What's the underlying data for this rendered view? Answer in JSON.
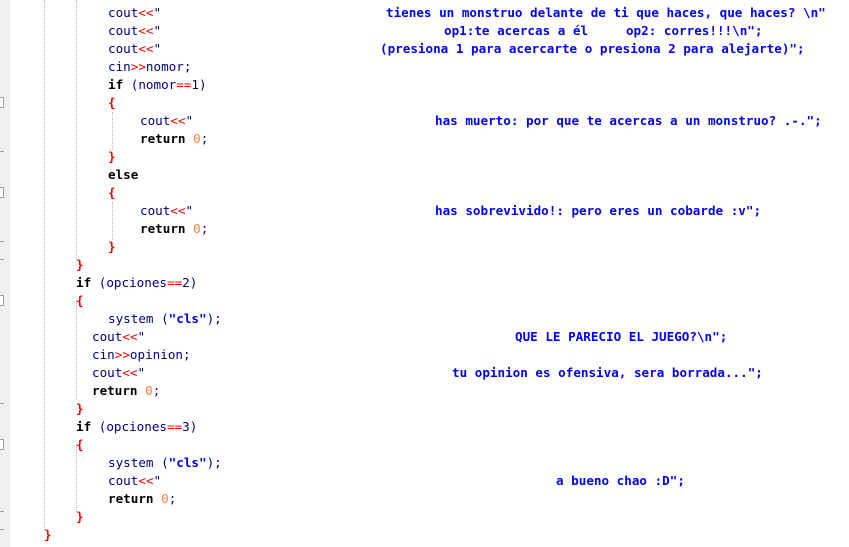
{
  "editor": {
    "language": "C++",
    "lines": [
      {
        "tokens": [
          {
            "t": "cout",
            "c": "code"
          },
          {
            "t": "<<",
            "c": "op"
          },
          {
            "t": "\"",
            "c": "code"
          }
        ],
        "tail": "tienes un monstruo delante de ti que haces, que haces? \\n\""
      },
      {
        "tokens": [
          {
            "t": "cout",
            "c": "code"
          },
          {
            "t": "<<",
            "c": "op"
          },
          {
            "t": "\"",
            "c": "code"
          }
        ],
        "tail": "op1:te acercas a él     op2: corres!!!\\n\";"
      },
      {
        "tokens": [
          {
            "t": "cout",
            "c": "code"
          },
          {
            "t": "<<",
            "c": "op"
          },
          {
            "t": "\"",
            "c": "code"
          }
        ],
        "tail": "(presiona 1 para acercarte o presiona 2 para alejarte)\";"
      },
      {
        "tokens": [
          {
            "t": "cin",
            "c": "code"
          },
          {
            "t": ">>",
            "c": "op"
          },
          {
            "t": "nomor;",
            "c": "code"
          }
        ]
      },
      {
        "tokens": [
          {
            "t": "if",
            "c": "kw"
          },
          {
            "t": " (nomor",
            "c": "code"
          },
          {
            "t": "==",
            "c": "op"
          },
          {
            "t": "1)",
            "c": "code"
          }
        ]
      },
      {
        "tokens": [
          {
            "t": "{",
            "c": "brace"
          }
        ]
      },
      {
        "tokens": [
          {
            "t": "cout",
            "c": "code"
          },
          {
            "t": "<<",
            "c": "op"
          },
          {
            "t": "\"",
            "c": "code"
          }
        ],
        "tail": "has muerto: por que te acercas a un monstruo? .-.\";"
      },
      {
        "tokens": [
          {
            "t": "return",
            "c": "kw"
          },
          {
            "t": " ",
            "c": "code"
          },
          {
            "t": "0",
            "c": "num"
          },
          {
            "t": ";",
            "c": "code"
          }
        ]
      },
      {
        "tokens": [
          {
            "t": "}",
            "c": "brace"
          }
        ]
      },
      {
        "tokens": [
          {
            "t": "else",
            "c": "kw"
          }
        ]
      },
      {
        "tokens": [
          {
            "t": "{",
            "c": "brace"
          }
        ]
      },
      {
        "tokens": [
          {
            "t": "cout",
            "c": "code"
          },
          {
            "t": "<<",
            "c": "op"
          },
          {
            "t": "\"",
            "c": "code"
          }
        ],
        "tail": "has sobrevivido!: pero eres un cobarde :v\";"
      },
      {
        "tokens": [
          {
            "t": "return",
            "c": "kw"
          },
          {
            "t": " ",
            "c": "code"
          },
          {
            "t": "0",
            "c": "num"
          },
          {
            "t": ";",
            "c": "code"
          }
        ]
      },
      {
        "tokens": [
          {
            "t": "}",
            "c": "brace"
          }
        ]
      },
      {
        "tokens": [
          {
            "t": "}",
            "c": "brace"
          }
        ]
      },
      {
        "tokens": [
          {
            "t": "if",
            "c": "kw"
          },
          {
            "t": " (opciones",
            "c": "code"
          },
          {
            "t": "==",
            "c": "op"
          },
          {
            "t": "2)",
            "c": "code"
          }
        ]
      },
      {
        "tokens": [
          {
            "t": "{",
            "c": "brace"
          }
        ]
      },
      {
        "tokens": [
          {
            "t": "system (",
            "c": "code"
          },
          {
            "t": "\"cls\"",
            "c": "str"
          },
          {
            "t": ");",
            "c": "code"
          }
        ]
      },
      {
        "tokens": [
          {
            "t": "cout",
            "c": "code"
          },
          {
            "t": "<<",
            "c": "op"
          },
          {
            "t": "\"",
            "c": "code"
          }
        ],
        "tail": "QUE LE PARECIO EL JUEGO?\\n\";"
      },
      {
        "tokens": [
          {
            "t": "cin",
            "c": "code"
          },
          {
            "t": ">>",
            "c": "op"
          },
          {
            "t": "opinion;",
            "c": "code"
          }
        ]
      },
      {
        "tokens": [
          {
            "t": "cout",
            "c": "code"
          },
          {
            "t": "<<",
            "c": "op"
          },
          {
            "t": "\"",
            "c": "code"
          }
        ],
        "tail": "tu opinion es ofensiva, sera borrada...\";"
      },
      {
        "tokens": [
          {
            "t": "return",
            "c": "kw"
          },
          {
            "t": " ",
            "c": "code"
          },
          {
            "t": "0",
            "c": "num"
          },
          {
            "t": ";",
            "c": "code"
          }
        ]
      },
      {
        "tokens": [
          {
            "t": "}",
            "c": "brace"
          }
        ]
      },
      {
        "tokens": [
          {
            "t": "if",
            "c": "kw"
          },
          {
            "t": " (opciones",
            "c": "code"
          },
          {
            "t": "==",
            "c": "op"
          },
          {
            "t": "3)",
            "c": "code"
          }
        ]
      },
      {
        "tokens": [
          {
            "t": "{",
            "c": "brace"
          }
        ]
      },
      {
        "tokens": [
          {
            "t": "system (",
            "c": "code"
          },
          {
            "t": "\"cls\"",
            "c": "str"
          },
          {
            "t": ");",
            "c": "code"
          }
        ]
      },
      {
        "tokens": [
          {
            "t": "cout",
            "c": "code"
          },
          {
            "t": "<<",
            "c": "op"
          },
          {
            "t": "\"",
            "c": "code"
          }
        ],
        "tail": "a bueno chao :D\";"
      },
      {
        "tokens": [
          {
            "t": "return",
            "c": "kw"
          },
          {
            "t": " ",
            "c": "code"
          },
          {
            "t": "0",
            "c": "num"
          },
          {
            "t": ";",
            "c": "code"
          }
        ]
      },
      {
        "tokens": [
          {
            "t": "}",
            "c": "brace"
          }
        ]
      },
      {
        "tokens": [
          {
            "t": "}",
            "c": "brace"
          }
        ]
      }
    ]
  },
  "colors": {
    "identifier": "#000080",
    "keyword": "#000000",
    "operator": "#ff0000",
    "number": "#ff8040",
    "string": "#0000ff",
    "brace": "#ff0000",
    "gutter": "#f0f0f0"
  }
}
